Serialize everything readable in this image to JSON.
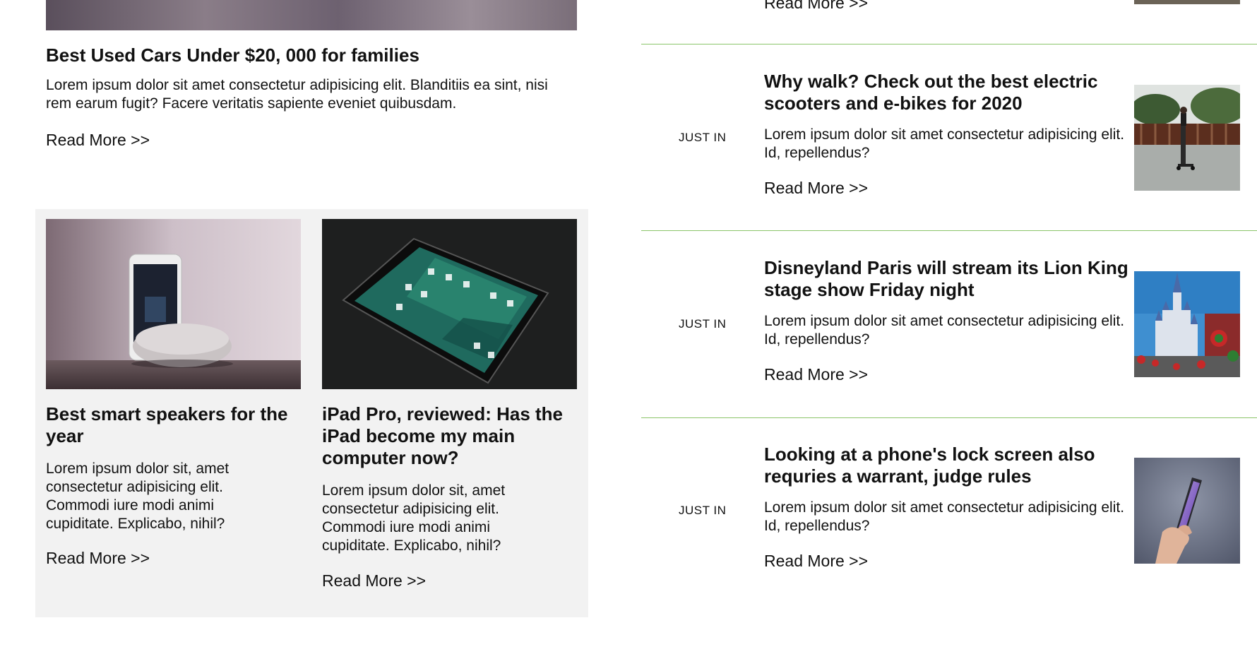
{
  "featured": {
    "title": "Best Used Cars Under $20, 000 for families",
    "description": "Lorem ipsum dolor sit amet consectetur adipisicing elit. Blanditiis ea sint, nisi rem earum fugit? Facere veritatis sapiente eveniet quibusdam.",
    "read_more": "Read More >>"
  },
  "cards": [
    {
      "title": "Best smart speakers for the year",
      "description": "Lorem ipsum dolor sit, amet consectetur adipisicing elit. Commodi iure modi animi cupiditate. Explicabo, nihil?",
      "read_more": "Read More >>"
    },
    {
      "title": "iPad Pro, reviewed: Has the iPad become my main computer now?",
      "description": "Lorem ipsum dolor sit, amet consectetur adipisicing elit. Commodi iure modi animi cupiditate. Explicabo, nihil?",
      "read_more": "Read More >>"
    }
  ],
  "sidebar": {
    "top_read_more": "Read More >>",
    "items": [
      {
        "tag": "JUST IN",
        "title": "Why walk? Check out the best electric scooters and e-bikes for 2020",
        "description": "Lorem ipsum dolor sit amet consectetur adipisicing elit. Id, repellendus?",
        "read_more": "Read More >>"
      },
      {
        "tag": "JUST IN",
        "title": "Disneyland Paris will stream its Lion King stage show Friday night",
        "description": "Lorem ipsum dolor sit amet consectetur adipisicing elit. Id, repellendus?",
        "read_more": "Read More >>"
      },
      {
        "tag": "JUST IN",
        "title": "Looking at a phone's lock screen also requries a warrant, judge rules",
        "description": "Lorem ipsum dolor sit amet consectetur adipisicing elit. Id, repellendus?",
        "read_more": "Read More >>"
      }
    ]
  },
  "colors": {
    "divider": "#8bc56a",
    "panel_bg": "#f2f2f2",
    "text": "#111111"
  }
}
